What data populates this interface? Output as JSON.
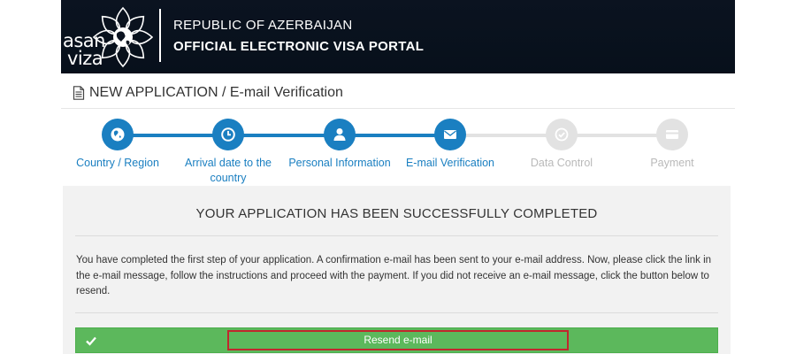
{
  "header": {
    "logo": {
      "line1": "asan",
      "line2": "viza"
    },
    "subtitle": "REPUBLIC OF AZERBAIJAN",
    "title": "OFFICIAL ELECTRONIC VISA PORTAL"
  },
  "page": {
    "heading": "NEW APPLICATION / E-mail Verification",
    "heading_icon": "document-icon"
  },
  "stepper": {
    "active_color": "#1a7fc1",
    "inactive_color": "#e2e2e2",
    "steps": [
      {
        "label": "Country / Region",
        "icon": "globe-icon",
        "state": "completed"
      },
      {
        "label": "Arrival date to the country",
        "icon": "clock-icon",
        "state": "completed"
      },
      {
        "label": "Personal Information",
        "icon": "user-icon",
        "state": "completed"
      },
      {
        "label": "E-mail Verification",
        "icon": "envelope-icon",
        "state": "current"
      },
      {
        "label": "Data Control",
        "icon": "check-circle-icon",
        "state": "pending"
      },
      {
        "label": "Payment",
        "icon": "credit-card-icon",
        "state": "pending"
      }
    ]
  },
  "panel": {
    "title": "YOUR APPLICATION HAS BEEN SUCCESSFULLY COMPLETED",
    "message": "You have completed the first step of your application. A confirmation e-mail has been sent to your e-mail address. Now, please click the link in the e-mail message, follow the instructions and proceed with the payment. If you did not receive an e-mail message, click the button below to resend."
  },
  "resend": {
    "label": "Resend e-mail",
    "icon": "check-icon",
    "color": "#5cb85c",
    "highlight_color": "#c0272d"
  }
}
